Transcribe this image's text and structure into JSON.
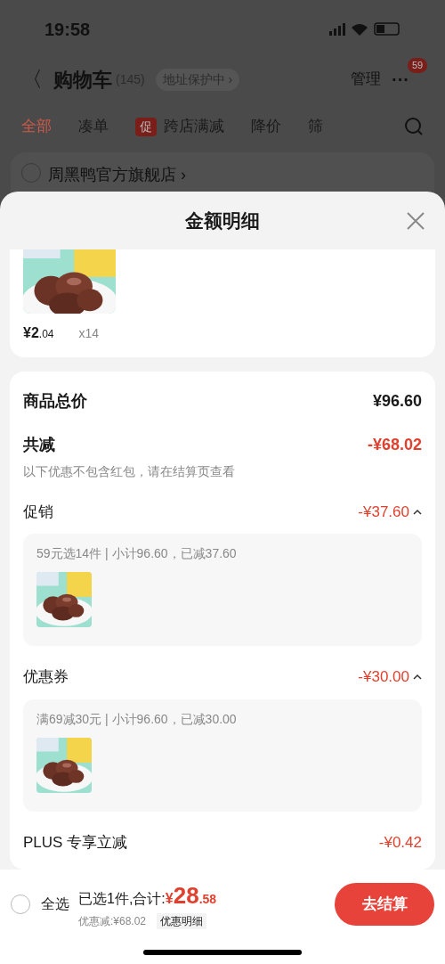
{
  "status_bar": {
    "time": "19:58"
  },
  "nav": {
    "back": "〈",
    "title": "购物车",
    "count": "(145)",
    "address": "地址保护中",
    "address_arrow": "›",
    "manage": "管理",
    "more": "···",
    "more_badge": "59"
  },
  "tabs": [
    {
      "label": "全部",
      "selected": true
    },
    {
      "label": "凑单",
      "selected": false
    },
    {
      "label": "跨店满减",
      "selected": false,
      "tag": "促"
    },
    {
      "label": "降价",
      "selected": false
    },
    {
      "label": "筛",
      "selected": false
    }
  ],
  "store": {
    "name": "周黑鸭官方旗舰店",
    "arrow": "›",
    "checked": false
  },
  "sheet": {
    "title": "金额明细",
    "product": {
      "price_int": "¥2",
      "price_dec": ".04",
      "qty": "x14"
    },
    "total": {
      "label": "商品总价",
      "value": "¥96.60"
    },
    "reduction": {
      "label": "共减",
      "value": "-¥68.02",
      "note": "以下优惠不包含红包，请在结算页查看"
    },
    "sections": [
      {
        "label": "促销",
        "value": "-¥37.60",
        "expanded": true,
        "detail": "59元选14件 | 小计96.60，已减37.60"
      },
      {
        "label": "优惠券",
        "value": "-¥30.00",
        "expanded": true,
        "detail": "满69减30元 | 小计96.60，已减30.00"
      },
      {
        "label": "PLUS 专享立减",
        "value": "-¥0.42"
      }
    ]
  },
  "bottom": {
    "select_all": "全选",
    "checked": false,
    "summary": "已选1件,合计:",
    "currency": "¥",
    "amount_int": "28",
    "amount_dec": ".58",
    "discount": "优惠减:¥68.02",
    "detail_link": "优惠明细",
    "checkout": "去结算"
  }
}
